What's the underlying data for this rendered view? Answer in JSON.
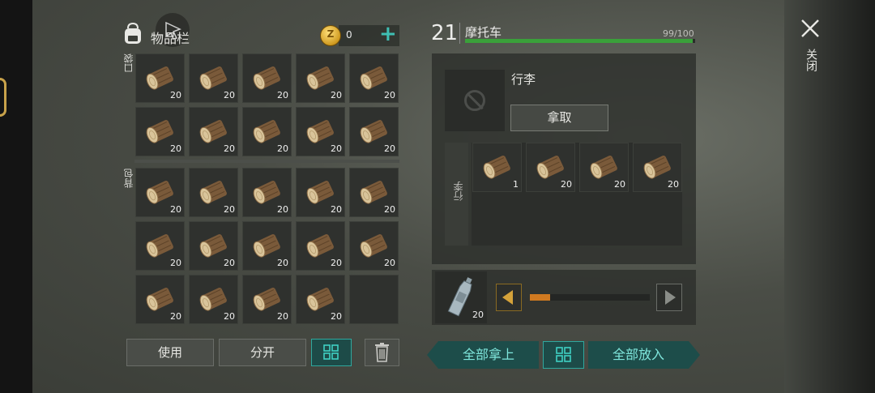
{
  "inventory": {
    "title": "物品栏",
    "coins": "0",
    "pocket_label": "口袋",
    "backpack_label": "背包",
    "pocket_items": [
      "20",
      "20",
      "20",
      "20",
      "20",
      "20",
      "20",
      "20",
      "20",
      "20"
    ],
    "backpack_items": [
      "20",
      "20",
      "20",
      "20",
      "20",
      "20",
      "20",
      "20",
      "20",
      "20",
      "20",
      "20",
      "20",
      "20",
      ""
    ]
  },
  "buttons": {
    "use": "使用",
    "split": "分开",
    "take_all": "全部拿上",
    "put_all": "全部放入",
    "take": "拿取"
  },
  "vehicle": {
    "level": "21",
    "name": "摩托车",
    "durability": "99/100",
    "durability_fraction": 0.99
  },
  "storage": {
    "title": "行李",
    "side_label": "行李",
    "items": [
      "1",
      "20",
      "20",
      "20"
    ]
  },
  "fuel": {
    "item_qty": "20",
    "slider_fraction": 0.17
  },
  "close_label": "关闭",
  "colors": {
    "accent_teal": "#2fa89e",
    "durability_green": "#3aa03a",
    "slider_orange": "#d07a20"
  }
}
